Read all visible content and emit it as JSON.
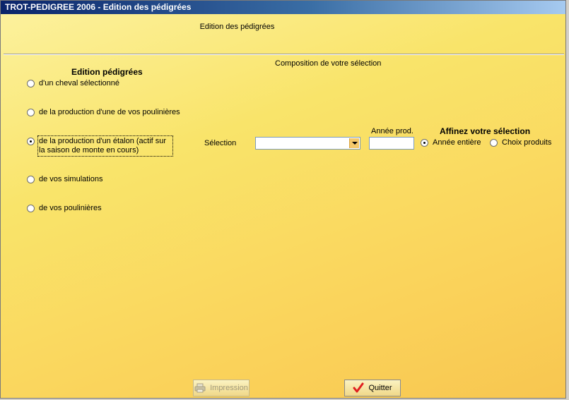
{
  "window": {
    "title": "TROT-PEDIGREE 2006  -  Edition des pédigrées",
    "header": "Edition des pédigrées"
  },
  "group": {
    "title": "Composition de votre sélection"
  },
  "edition": {
    "title": "Edition pédigrées",
    "options": [
      {
        "label": "d'un cheval sélectionné",
        "selected": false
      },
      {
        "label": "de la production d'une de vos poulinières",
        "selected": false
      },
      {
        "label": "de la production d'un étalon (actif sur la saison de monte en cours)",
        "selected": true
      },
      {
        "label": "de vos simulations",
        "selected": false
      },
      {
        "label": "de vos poulinières",
        "selected": false
      }
    ]
  },
  "selection": {
    "label": "Sélection",
    "value": ""
  },
  "annee": {
    "label": "Année prod.",
    "value": ""
  },
  "affinez": {
    "title": "Affinez votre sélection",
    "options": [
      {
        "label": "Année entière",
        "selected": true
      },
      {
        "label": "Choix produits",
        "selected": false
      }
    ]
  },
  "buttons": {
    "impression": "Impression",
    "quitter": "Quitter"
  },
  "colors": {
    "titlebar": "#0a246a",
    "background": "#f9e46a",
    "quitter_icon": "#e02020"
  },
  "icons": {
    "impression": "printer-icon",
    "quitter": "checkmark-icon"
  }
}
